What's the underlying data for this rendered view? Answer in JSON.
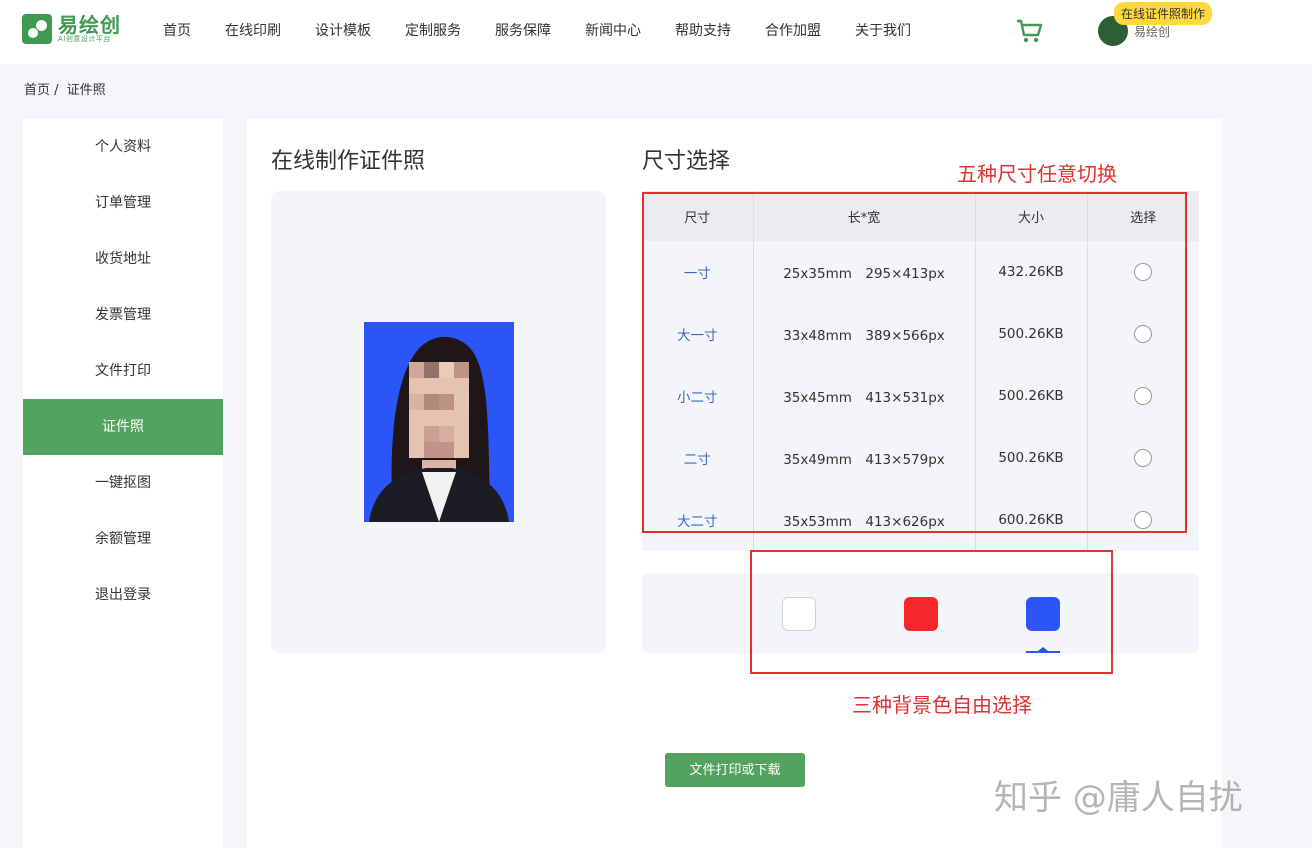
{
  "header": {
    "logo_name": "易绘创",
    "logo_sub": "AI创意设计平台",
    "nav": [
      "首页",
      "在线印刷",
      "设计模板",
      "定制服务",
      "服务保障",
      "新闻中心",
      "帮助支持",
      "合作加盟",
      "关于我们"
    ],
    "cart_icon": "cart-icon",
    "username": "易绘创",
    "badge": "在线证件照制作"
  },
  "breadcrumb": {
    "home": "首页 /",
    "current": "证件照"
  },
  "sidebar": {
    "items": [
      "个人资料",
      "订单管理",
      "收货地址",
      "发票管理",
      "文件打印",
      "证件照",
      "一键抠图",
      "余额管理",
      "退出登录"
    ],
    "active": "证件照"
  },
  "main": {
    "left_title": "在线制作证件照",
    "right_title": "尺寸选择",
    "table": {
      "headers": [
        "尺寸",
        "长*宽",
        "大小",
        "选择"
      ],
      "rows": [
        {
          "name": "一寸",
          "dims": "25x35mm　295×413px",
          "size": "432.26KB"
        },
        {
          "name": "大一寸",
          "dims": "33x48mm　389×566px",
          "size": "500.26KB"
        },
        {
          "name": "小二寸",
          "dims": "35x45mm　413×531px",
          "size": "500.26KB"
        },
        {
          "name": "二寸",
          "dims": "35x49mm　413×579px",
          "size": "500.26KB"
        },
        {
          "name": "大二寸",
          "dims": "35x53mm　413×626px",
          "size": "600.26KB"
        }
      ]
    },
    "colors": {
      "white": "#ffffff",
      "red": "#f5272b",
      "blue": "#2b55f6",
      "selected": "blue"
    },
    "action_button": "文件打印或下载"
  },
  "annotations": {
    "sizes": "五种尺寸任意切换",
    "colors": "三种背景色自由选择"
  },
  "watermark": "知乎 @庸人自扰",
  "theme": {
    "accent": "#52a35e",
    "annotation": "#e0322e"
  }
}
